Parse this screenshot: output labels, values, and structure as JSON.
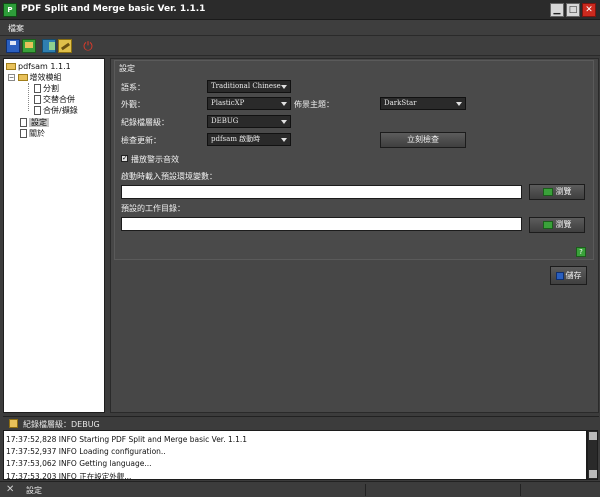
{
  "window": {
    "title": "PDF Split and Merge basic Ver. 1.1.1",
    "app_icon": "pdfsam-icon"
  },
  "menubar": {
    "file": "檔案"
  },
  "toolbar": {
    "icons": [
      "save-icon",
      "open-icon",
      "export-icon",
      "edit-icon",
      "power-icon"
    ]
  },
  "tree": {
    "root": "pdfsam 1.1.1",
    "plugins_folder": "增效模組",
    "items": [
      "分割",
      "交替合併",
      "合併/擷錄"
    ],
    "settings": "設定",
    "about": "關於"
  },
  "settings": {
    "panel_title": "設定",
    "language_label": "語系：",
    "language_value": "Traditional Chinese",
    "look_label": "外觀：",
    "look_value": "PlasticXP",
    "theme_label": "佈景主題：",
    "theme_value": "DarkStar",
    "log_level_label": "紀錄檔層級：",
    "log_level_value": "DEBUG",
    "check_updates_label": "檢查更新：",
    "check_updates_value": "pdfsam 啟動時",
    "check_now_button": "立刻檢查",
    "play_sounds_label": "播放警示音效",
    "play_sounds_checked": true,
    "env_label": "啟動時載入預設環境變數：",
    "env_value": "",
    "browse_button_1": "瀏覽",
    "workdir_label": "預設的工作目錄：",
    "workdir_value": "",
    "browse_button_2": "瀏覽",
    "save_button": "儲存"
  },
  "log": {
    "header_label": "紀錄檔層級：DEBUG",
    "lines": [
      "17:37:52,828 INFO   Starting PDF Split and Merge basic Ver. 1.1.1",
      "17:37:52,937 INFO   Loading configuration..",
      "17:37:53,062 INFO   Getting language...",
      "17:37:53,203 INFO   正在設定外觀..."
    ]
  },
  "status": {
    "text": "設定"
  }
}
